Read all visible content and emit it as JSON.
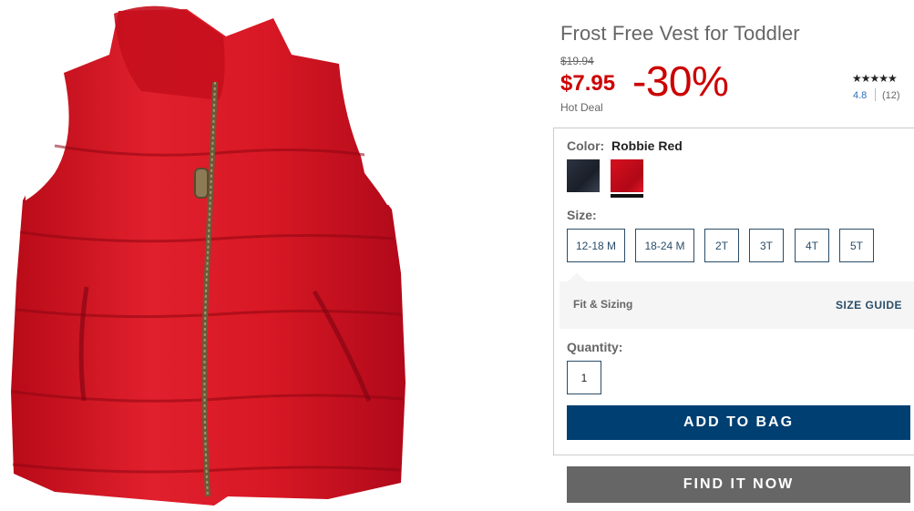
{
  "product": {
    "title": "Frost Free Vest for Toddler",
    "original_price": "$19.94",
    "sale_price": "$7.95",
    "discount": "-30%",
    "deal_label": "Hot Deal",
    "stars": "★★★★★",
    "rating": "4.8",
    "review_count": "(12)"
  },
  "color": {
    "label": "Color:",
    "selected": "Robbie Red",
    "swatches": [
      {
        "name": "navy",
        "hex": "#1f2430"
      },
      {
        "name": "red",
        "hex": "#c8101e",
        "selected": true
      }
    ]
  },
  "size": {
    "label": "Size:",
    "options": [
      "12-18 M",
      "18-24 M",
      "2T",
      "3T",
      "4T",
      "5T"
    ]
  },
  "fit": {
    "label": "Fit & Sizing",
    "guide_link": "SIZE GUIDE"
  },
  "quantity": {
    "label": "Quantity:",
    "value": "1"
  },
  "actions": {
    "add_to_bag": "ADD TO BAG",
    "find_it_now": "FIND IT NOW"
  },
  "colors": {
    "accent_red": "#cc0000",
    "primary_blue": "#003f72",
    "secondary_gray": "#666666"
  }
}
